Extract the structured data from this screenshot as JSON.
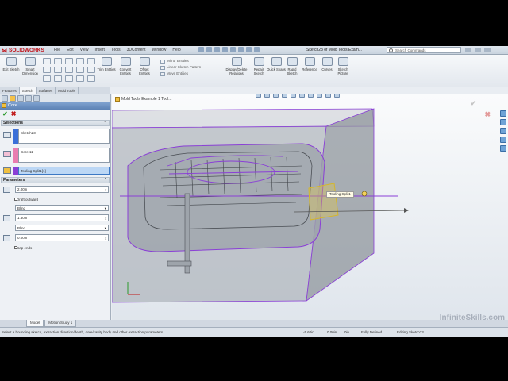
{
  "app": {
    "logo": "SOLIDWORKS",
    "menu": [
      "File",
      "Edit",
      "View",
      "Insert",
      "Tools",
      "3DContent",
      "Window",
      "Help"
    ],
    "document_title": "Sketch23 of Mold Tools Exam...",
    "search_placeholder": "Search Commands"
  },
  "command_manager": {
    "buttons": [
      {
        "id": "exit-sketch",
        "label": "Exit Sketch"
      },
      {
        "id": "smart-dimension",
        "label": "Smart Dimension"
      },
      {
        "id": "trim-entities",
        "label": "Trim Entities"
      },
      {
        "id": "convert-entities",
        "label": "Convert Entities"
      },
      {
        "id": "offset-entities",
        "label": "Offset Entities"
      },
      {
        "id": "display-delete-relations",
        "label": "Display/Delete Relations"
      },
      {
        "id": "repair-sketch",
        "label": "Repair Sketch"
      },
      {
        "id": "quick-snaps",
        "label": "Quick Snaps"
      },
      {
        "id": "rapid-sketch",
        "label": "Rapid Sketch"
      },
      {
        "id": "reference",
        "label": "Reference"
      },
      {
        "id": "curves",
        "label": "Curves"
      },
      {
        "id": "sketch-picture",
        "label": "Sketch Picture"
      }
    ],
    "mirror": [
      "Mirror Entities",
      "Linear Sketch Pattern",
      "Move Entities"
    ]
  },
  "tabs": [
    "Features",
    "Sketch",
    "Surfaces",
    "Mold Tools"
  ],
  "active_tab": "Sketch",
  "property_manager": {
    "title": "Core",
    "sections": {
      "selections": "Selections",
      "parameters": "Parameters"
    },
    "selections": {
      "sketch": "Sketch23",
      "core_body": "Core 11",
      "tooling_split": "Tooling Split1[1]"
    },
    "parameters": {
      "depth1": "2.00in",
      "draft_outward": "Draft outward",
      "end_condition1": "Blind",
      "depth2": "1.50in",
      "end_condition2": "Blind",
      "draft2": "0.00in",
      "cap_ends": "Cap ends"
    }
  },
  "viewport": {
    "tree_label": "Mold Tools Example 1 Tool...",
    "callout": "Tooling Split1",
    "watermark": "InfiniteSkills.com"
  },
  "bottom_tabs": [
    "Model",
    "Motion Study 1"
  ],
  "status": {
    "message": "Select a bounding sketch, extraction direction/depth, core/cavity body and other extraction parameters.",
    "x": "-5.60in",
    "y": "0.00in",
    "z": "0in",
    "state": "Fully Defined",
    "mode": "Editing Sketch23"
  },
  "colors": {
    "accent_red": "#c0141b",
    "selection_purple": "#8a3fd6",
    "highlight_yellow": "#e5c844"
  }
}
